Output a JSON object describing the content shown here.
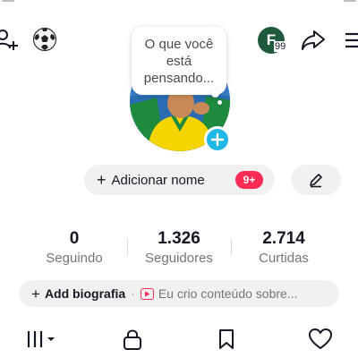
{
  "header": {
    "bubble_text": "O que você está pensando...",
    "avatar_letter": "F",
    "avatar_badge": "99"
  },
  "profile": {
    "add_name_label": "Adicionar nome",
    "notification_count": "9+"
  },
  "stats": [
    {
      "value": "0",
      "label": "Seguindo"
    },
    {
      "value": "1.326",
      "label": "Seguidores"
    },
    {
      "value": "2.714",
      "label": "Curtidas"
    }
  ],
  "bio": {
    "add_label": "Add biografia",
    "separator": "·",
    "suggestion": "Eu crio conteúdo sobre..."
  },
  "colors": {
    "accent_red": "#fe2c55",
    "accent_blue": "#20b8e6",
    "avatar_green": "#1f5a3e",
    "pill_bg": "#f1f1f2"
  },
  "icons": [
    "add-user-icon",
    "soccer-ball-icon",
    "share-icon",
    "menu-icon",
    "plus-icon",
    "pencil-icon",
    "video-icon",
    "grid-icon",
    "lock-icon",
    "bookmark-icon",
    "heart-icon"
  ]
}
